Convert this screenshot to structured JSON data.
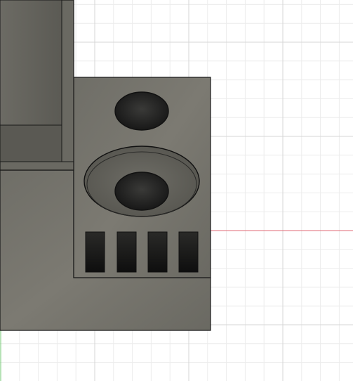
{
  "viewport": {
    "background_color": "#ffffff",
    "grid_minor_color": "#ececec",
    "grid_major_color": "#d6d6d6",
    "axis_x_color": "#e06a74",
    "axis_y_color": "#6cc56c"
  },
  "model": {
    "body_color": "#6b6a63",
    "edge_color": "#1a1a1a",
    "face_light": "#7a7870",
    "face_dark": "#4a4944",
    "hole_color": "#1c1c1c",
    "features": {
      "circular_holes": 2,
      "counterbore_ring": 1,
      "rectangular_slots": 4
    }
  }
}
